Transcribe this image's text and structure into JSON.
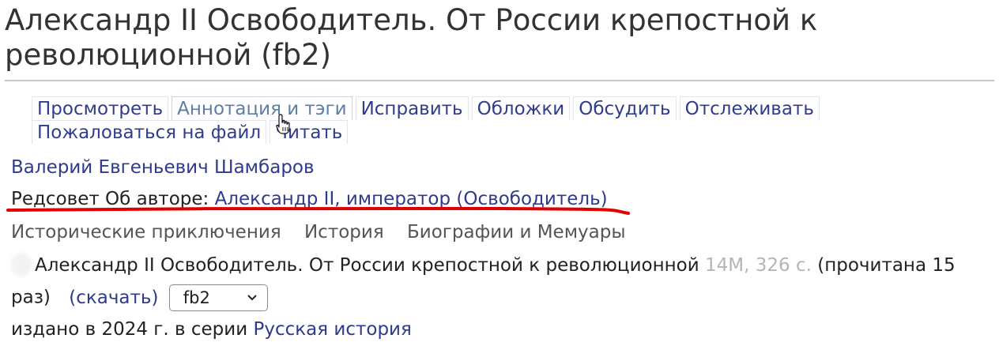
{
  "page": {
    "title": "Александр II Освободитель. От России крепостной к революционной (fb2)"
  },
  "tabs": {
    "row1": [
      {
        "label": "Просмотреть"
      },
      {
        "label": "Аннотация и тэги"
      },
      {
        "label": "Исправить"
      },
      {
        "label": "Обложки"
      },
      {
        "label": "Обсудить"
      },
      {
        "label": "Отслеживать"
      }
    ],
    "row2": [
      {
        "label": "Пожаловаться на файл"
      },
      {
        "label": "Читать"
      }
    ],
    "active": "Аннотация и тэги"
  },
  "author": {
    "name": "Валерий Евгеньевич Шамбаров"
  },
  "redsovet": {
    "label": "Редсовет Об авторе:",
    "link": "Александр II, император (Освободитель)"
  },
  "genres": [
    "Исторические приключения",
    "История",
    "Биографии и Мемуары"
  ],
  "file": {
    "title": "Александр II Освободитель. От России крепостной к революционной",
    "size_pages": "14M, 326 с.",
    "read_count_line1": "(прочитана 15",
    "read_count_line2": "раз)",
    "download_label": "(скачать)",
    "format": "fb2"
  },
  "publication": {
    "text": "издано в 2024 г. в серии",
    "series": "Русская история"
  },
  "colors": {
    "link": "#2f3a8e",
    "active_tab": "#5d7ea6",
    "annotation_underline": "#e00000",
    "muted": "#b5b5b5"
  },
  "icons": {
    "cursor": "hand-pointer-icon",
    "select_arrow": "chevron-down-icon"
  }
}
